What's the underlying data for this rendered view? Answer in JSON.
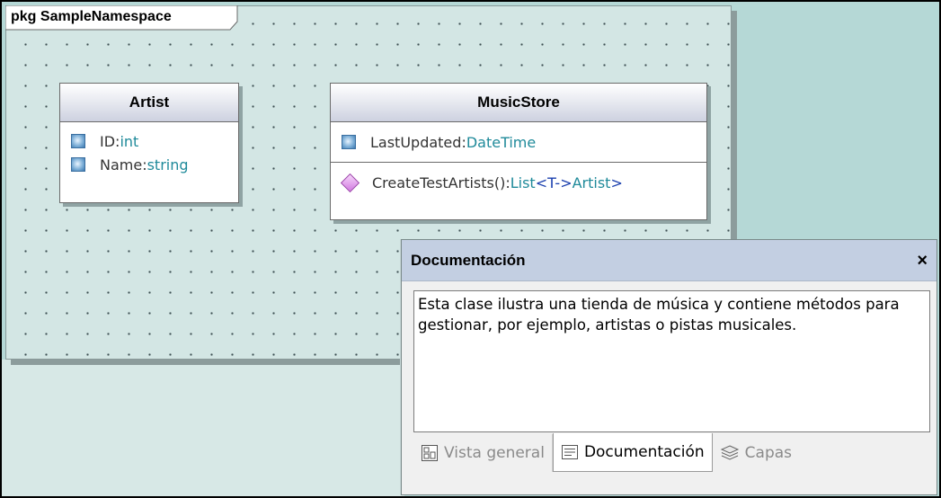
{
  "package": {
    "label": "pkg SampleNamespace"
  },
  "classes": {
    "artist": {
      "name": "Artist",
      "attributes": [
        {
          "name": "ID",
          "type": "int"
        },
        {
          "name": "Name",
          "type": "string"
        }
      ]
    },
    "music_store": {
      "name": "MusicStore",
      "attributes": [
        {
          "name": "LastUpdated",
          "type": "DateTime"
        }
      ],
      "operations": [
        {
          "signature": "CreateTestArtists():",
          "return_type": "List",
          "template": "<T->",
          "template_arg": "Artist",
          "template_close": ">"
        }
      ]
    }
  },
  "documentation_panel": {
    "title": "Documentación",
    "close_label": "×",
    "text": "Esta clase ilustra una tienda de música y contiene métodos para gestionar, por ejemplo, artistas o pistas musicales.",
    "tabs": [
      {
        "label": "Vista general",
        "icon": "overview-icon",
        "active": false
      },
      {
        "label": "Documentación",
        "icon": "documentation-icon",
        "active": true
      },
      {
        "label": "Capas",
        "icon": "layers-icon",
        "active": false
      }
    ]
  },
  "colors": {
    "background": "#b5d8d6",
    "package_fill": "#d3e6e4",
    "panel_title": "#c3cfe2",
    "type_text": "#1f8a9a"
  }
}
